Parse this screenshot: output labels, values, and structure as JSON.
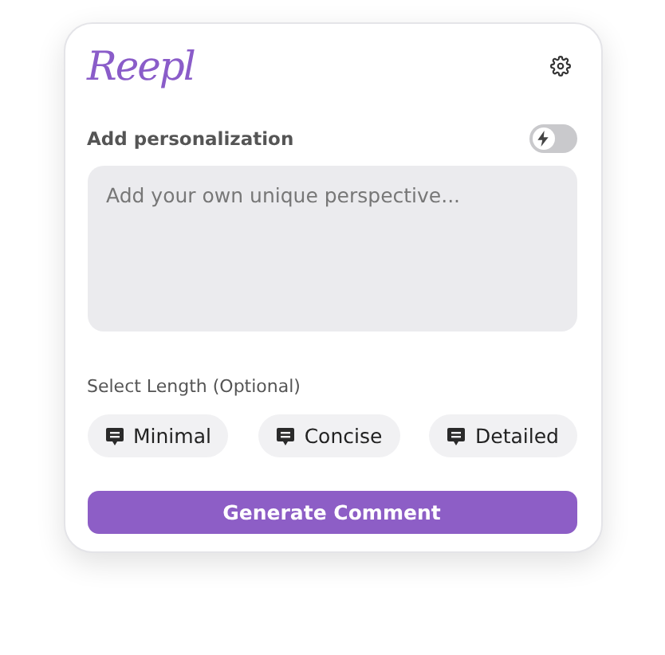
{
  "logo": "Reepl",
  "personalization": {
    "label": "Add personalization",
    "toggle_on": false,
    "placeholder": "Add your own unique perspective..."
  },
  "length": {
    "label": "Select Length (Optional)",
    "options": [
      {
        "label": "Minimal",
        "selected": false
      },
      {
        "label": "Concise",
        "selected": false
      },
      {
        "label": "Detailed",
        "selected": false
      }
    ]
  },
  "generate_button": "Generate Comment"
}
